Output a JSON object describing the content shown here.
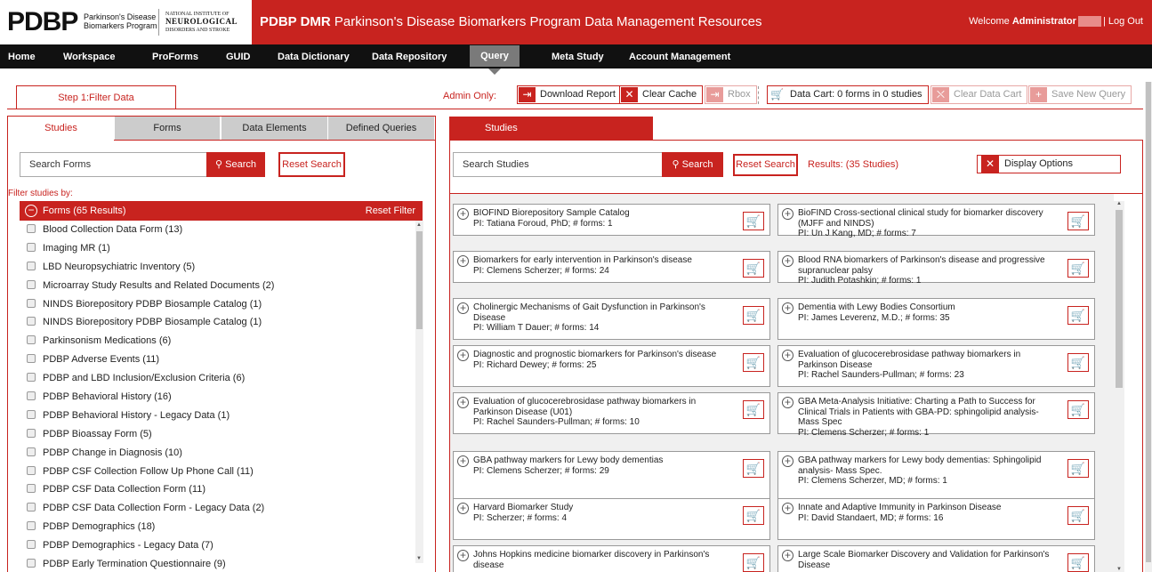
{
  "header": {
    "logo_text": "PDBP",
    "logo_sub_1": "Parkinson's Disease",
    "logo_sub_2": "Biomarkers Program",
    "ninds_1": "NATIONAL INSTITUTE OF",
    "ninds_2": "NEUROLOGICAL",
    "ninds_3": "DISORDERS AND STROKE",
    "title_bold": "PDBP DMR",
    "title_rest": " Parkinson's Disease Biomarkers Program Data Management Resources",
    "welcome": "Welcome ",
    "user": "Administrator",
    "logout": "| Log Out"
  },
  "nav": {
    "home": "Home",
    "workspace": "Workspace",
    "proforms": "ProForms",
    "guid": "GUID",
    "data_dictionary": "Data Dictionary",
    "data_repository": "Data Repository",
    "query": "Query",
    "meta_study": "Meta Study",
    "account_management": "Account Management"
  },
  "step_tab": "Step 1:Filter Data",
  "admin": {
    "label": "Admin Only:",
    "download_report": "Download Report",
    "clear_cache": "Clear Cache",
    "rbox": "Rbox",
    "data_cart": "Data Cart: 0 forms in 0 studies",
    "clear_data_cart": "Clear Data Cart",
    "save_new_query": "Save New Query"
  },
  "left": {
    "tabs": [
      "Studies",
      "Forms",
      "Data Elements",
      "Defined Queries"
    ],
    "search_placeholder": "Search Forms",
    "search_button": "Search",
    "reset_search": "Reset Search",
    "filter_label": "Filter studies by:",
    "filter_title": "Forms  (65 Results)",
    "reset_filter": "Reset Filter",
    "forms": [
      "Blood Collection Data Form (13)",
      "Imaging MR (1)",
      "LBD Neuropsychiatric Inventory (5)",
      "Microarray Study Results and Related Documents (2)",
      "NINDS Biorepository PDBP Biosample Catalog (1)",
      "NINDS Biorepository PDBP Biosample Catalog (1)",
      "Parkinsonism Medications (6)",
      "PDBP Adverse Events (11)",
      "PDBP and LBD Inclusion/Exclusion Criteria (6)",
      "PDBP Behavioral History (16)",
      "PDBP Behavioral History - Legacy Data (1)",
      "PDBP Bioassay Form (5)",
      "PDBP Change in Diagnosis (10)",
      "PDBP CSF Collection Follow Up Phone Call (11)",
      "PDBP CSF Data Collection Form (11)",
      "PDBP CSF Data Collection Form - Legacy Data (2)",
      "PDBP Demographics (18)",
      "PDBP Demographics - Legacy Data (7)",
      "PDBP Early Termination Questionnaire (9)"
    ]
  },
  "right": {
    "tab": "Studies",
    "search_placeholder": "Search Studies",
    "search_button": "Search",
    "reset_search": "Reset Search",
    "results": "Results: (35 Studies)",
    "display_options": "Display Options",
    "studies": [
      {
        "title": "BIOFIND Biorepository Sample Catalog",
        "pi": "PI: Tatiana Foroud, PhD; # forms: 1"
      },
      {
        "title": "BioFIND Cross-sectional clinical study for biomarker discovery (MJFF and NINDS)",
        "pi": "PI: Un J Kang, MD; # forms: 7"
      },
      {
        "title": "Biomarkers for early intervention in Parkinson's disease",
        "pi": "PI: Clemens Scherzer; # forms: 24"
      },
      {
        "title": "Blood RNA biomarkers of Parkinson's disease and progressive supranuclear palsy",
        "pi": "PI: Judith Potashkin; # forms: 1"
      },
      {
        "title": "Cholinergic Mechanisms of Gait Dysfunction in Parkinson's Disease",
        "pi": "PI: William T Dauer; # forms: 14"
      },
      {
        "title": "Dementia with Lewy Bodies Consortium",
        "pi": "PI: James Leverenz, M.D.; # forms: 35"
      },
      {
        "title": "Diagnostic and prognostic biomarkers for Parkinson's disease",
        "pi": "PI: Richard Dewey; # forms: 25"
      },
      {
        "title": "Evaluation of glucocerebrosidase pathway biomarkers in Parkinson Disease",
        "pi": "PI: Rachel Saunders-Pullman; # forms: 23"
      },
      {
        "title": "Evaluation of glucocerebrosidase pathway biomarkers in Parkinson Disease (U01)",
        "pi": "PI: Rachel Saunders-Pullman; # forms: 10"
      },
      {
        "title": "GBA Meta-Analysis Initiative: Charting a Path to Success for Clinical Trials in Patients with GBA-PD: sphingolipid analysis- Mass Spec",
        "pi": "PI: Clemens Scherzer; # forms: 1"
      },
      {
        "title": "GBA pathway markers for Lewy body dementias",
        "pi": "PI: Clemens Scherzer; # forms: 29"
      },
      {
        "title": "GBA pathway markers for Lewy body dementias: Sphingolipid analysis- Mass Spec.",
        "pi": "PI: Clemens Scherzer, MD; # forms: 1"
      },
      {
        "title": "Harvard Biomarker Study",
        "pi": "PI: Scherzer; # forms: 4"
      },
      {
        "title": "Innate and Adaptive Immunity in Parkinson Disease",
        "pi": "PI: David Standaert, MD; # forms: 16"
      },
      {
        "title": "Johns Hopkins medicine biomarker discovery in Parkinson's disease",
        "pi": ""
      },
      {
        "title": "Large Scale Biomarker Discovery and Validation for Parkinson's Disease",
        "pi": ""
      }
    ]
  }
}
